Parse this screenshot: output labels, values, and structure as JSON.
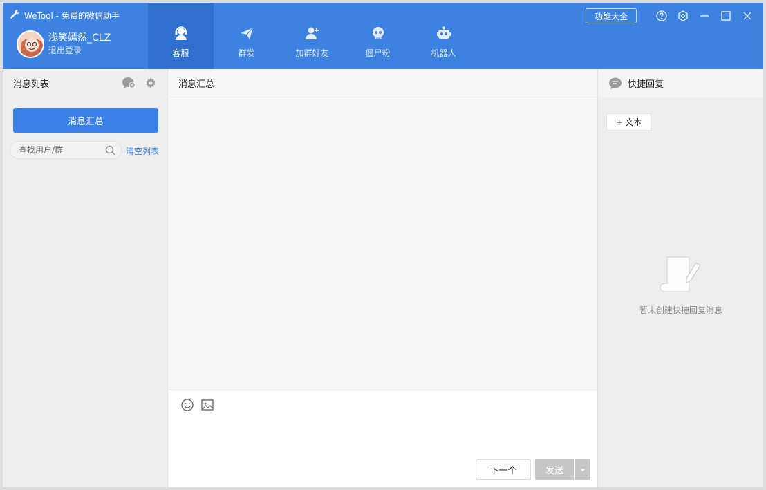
{
  "app": {
    "title": "WeTool - 免费的微信助手"
  },
  "user": {
    "name": "浅笑嫣然_CLZ",
    "logout_label": "退出登录"
  },
  "nav": {
    "tabs": [
      {
        "label": "客服",
        "icon": "customer-service-icon",
        "active": true
      },
      {
        "label": "群发",
        "icon": "send-plane-icon",
        "active": false
      },
      {
        "label": "加群好友",
        "icon": "add-friend-icon",
        "active": false
      },
      {
        "label": "僵尸粉",
        "icon": "skull-icon",
        "active": false
      },
      {
        "label": "机器人",
        "icon": "robot-icon",
        "active": false
      }
    ]
  },
  "window_controls": {
    "feature_label": "功能大全"
  },
  "left": {
    "title": "消息列表",
    "summary_button": "消息汇总",
    "search_placeholder": "查找用户/群",
    "clear_link": "清空列表"
  },
  "center": {
    "title": "消息汇总",
    "compose": {
      "next_label": "下一个",
      "send_label": "发送"
    }
  },
  "right": {
    "title": "快捷回复",
    "add_text_label": "+ 文本",
    "empty_text": "暂未创建快捷回复消息"
  },
  "colors": {
    "header_blue": "#3d82e0",
    "active_tab": "#2f70cf",
    "accent": "#3a80e6",
    "send_disabled": "#c6c6c6"
  }
}
